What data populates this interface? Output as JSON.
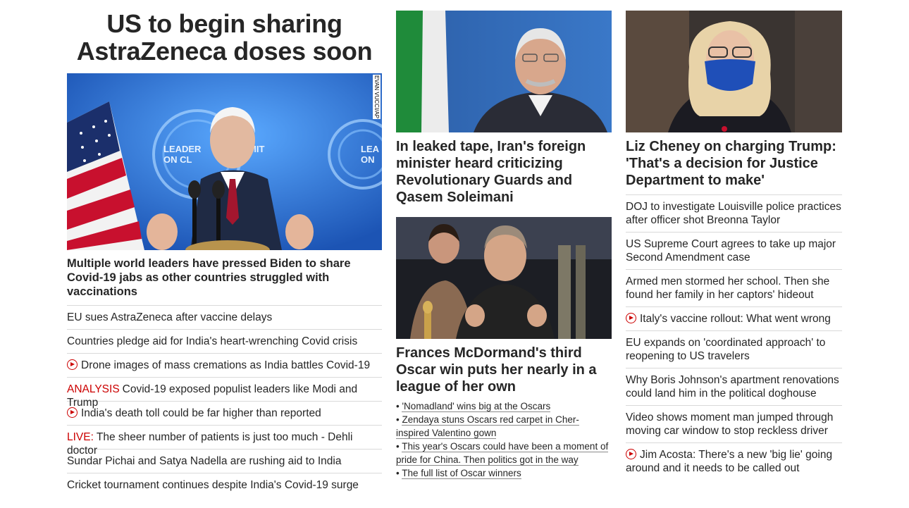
{
  "left": {
    "headline": "US to begin sharing AstraZeneca doses soon",
    "photo_credit": "EVAN VUCCI/AP",
    "hero_caption": "Multiple world leaders have pressed Biden to share Covid-19 jabs as other countries struggled with vaccinations",
    "hero_sign_text": "LEADERS SUMMIT ON CLIMATE",
    "links": [
      {
        "prefix": "",
        "icon": "",
        "text": "EU sues AstraZeneca after vaccine delays"
      },
      {
        "prefix": "",
        "icon": "",
        "text": "Countries pledge aid for India's heart-wrenching Covid crisis"
      },
      {
        "prefix": "",
        "icon": "play-icon",
        "text": "Drone images of mass cremations as India battles Covid-19"
      },
      {
        "prefix": "ANALYSIS",
        "icon": "",
        "text": "Covid-19 exposed populist leaders like Modi and Trump"
      },
      {
        "prefix": "",
        "icon": "play-icon",
        "text": "India's death toll could be far higher than reported"
      },
      {
        "prefix": "LIVE:",
        "icon": "",
        "text": "The sheer number of patients is just too much - Dehli doctor"
      },
      {
        "prefix": "",
        "icon": "",
        "text": "Sundar Pichai and Satya Nadella are rushing aid to India"
      },
      {
        "prefix": "",
        "icon": "",
        "text": "Cricket tournament continues despite India's Covid-19 surge"
      }
    ]
  },
  "middle": {
    "story1_headline": "In leaked tape, Iran's foreign minister heard criticizing Revolutionary Guards and Qasem Soleimani",
    "story2_headline": "Frances McDormand's third Oscar win puts her nearly in a league of her own",
    "story2_links": [
      "'Nomadland' wins big at the Oscars",
      "Zendaya stuns Oscars red carpet in Cher-inspired Valentino gown",
      "This year's Oscars could have been a moment of pride for China. Then politics got in the way",
      "The full list of Oscar winners"
    ]
  },
  "right": {
    "headline": "Liz Cheney on charging Trump: 'That's a decision for Justice Department to make'",
    "links": [
      {
        "icon": "",
        "text": "DOJ to investigate Louisville police practices after officer shot Breonna Taylor"
      },
      {
        "icon": "",
        "text": "US Supreme Court agrees to take up major Second Amendment case"
      },
      {
        "icon": "",
        "text": "Armed men stormed her school. Then she found her family in her captors' hideout"
      },
      {
        "icon": "play-icon",
        "text": "Italy's vaccine rollout: What went wrong"
      },
      {
        "icon": "",
        "text": "EU expands on 'coordinated approach' to reopening to US travelers"
      },
      {
        "icon": "",
        "text": "Why Boris Johnson's apartment renovations could land him in the political doghouse"
      },
      {
        "icon": "",
        "text": "Video shows moment man jumped through moving car window to stop reckless driver"
      },
      {
        "icon": "play-icon",
        "text": "Jim Acosta: There's a new 'big lie' going around and it needs to be called out"
      }
    ]
  },
  "colors": {
    "text": "#262626",
    "accent_red": "#cc0000",
    "divider": "#d9d9d9"
  }
}
